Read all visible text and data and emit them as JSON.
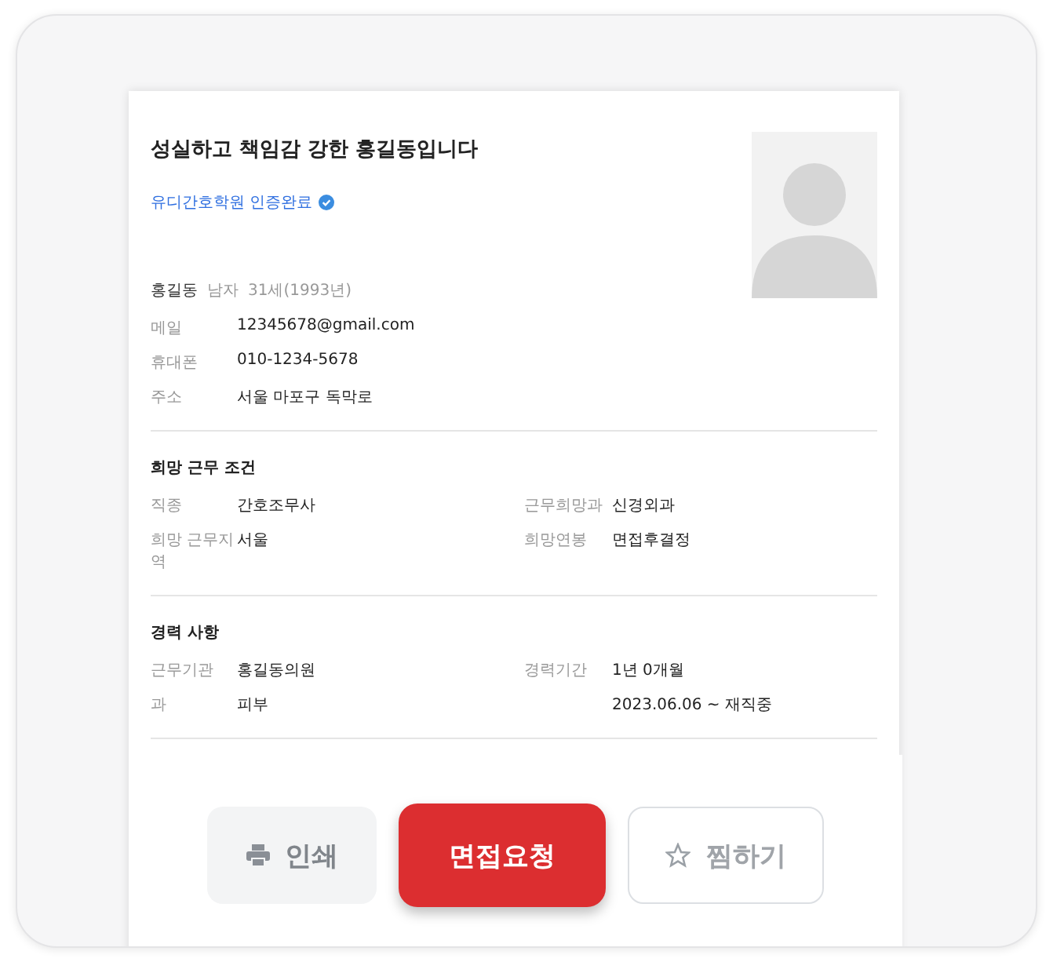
{
  "resume": {
    "headline": "성실하고 책임감 강한 홍길동입니다",
    "certification": {
      "label": "유디간호학원 인증완료",
      "verified": true
    },
    "name": "홍길동",
    "gender": "남자",
    "age": "31세(1993년)",
    "contacts": [
      {
        "label": "메일",
        "value": "12345678@gmail.com"
      },
      {
        "label": "휴대폰",
        "value": "010-1234-5678"
      },
      {
        "label": "주소",
        "value": "서울 마포구 독막로"
      }
    ],
    "sections": [
      {
        "title": "희망 근무 조건",
        "rows": [
          {
            "label": "직종",
            "value": "간호조무사",
            "label_2": "근무희망과",
            "value_2": "신경외과"
          },
          {
            "label": "희망 근무지역",
            "value": "서울",
            "label_2": "희망연봉",
            "value_2": "면접후결정"
          }
        ]
      },
      {
        "title": "경력 사항",
        "rows": [
          {
            "label": "근무기관",
            "value": "홍길동의원",
            "label_2": "경력기간",
            "value_2": "1년 0개월"
          },
          {
            "label": "과",
            "value": "피부",
            "value_2": "2023.06.06 ~ 재직중"
          }
        ]
      }
    ]
  },
  "actions": [
    {
      "kind": "print",
      "label": "인쇄"
    },
    {
      "kind": "primary",
      "label": "면접요청"
    },
    {
      "kind": "favorite",
      "label": "찜하기"
    }
  ]
}
